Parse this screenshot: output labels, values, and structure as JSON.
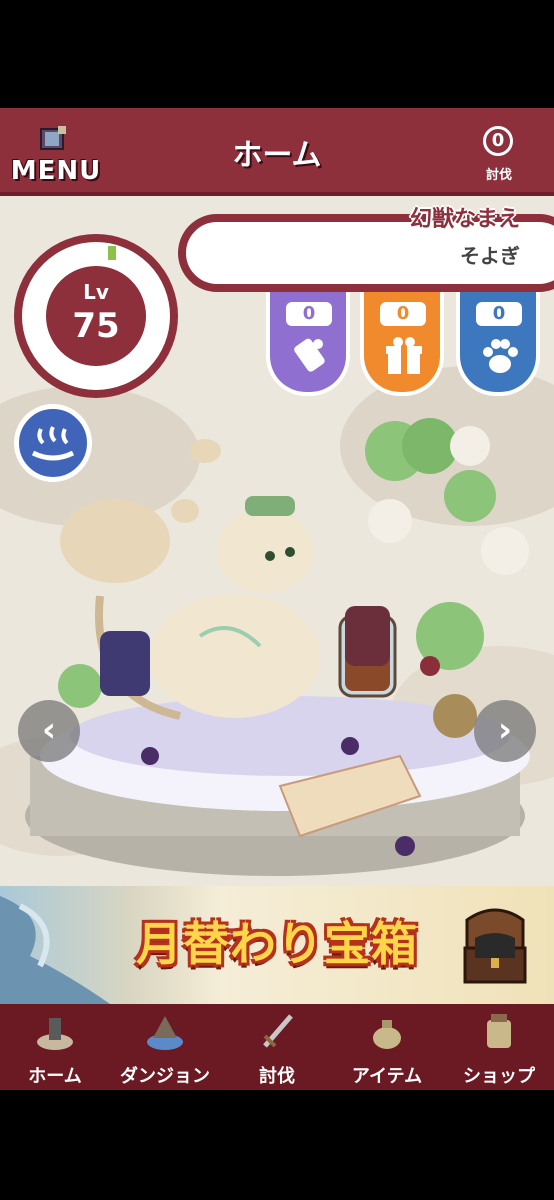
{
  "header": {
    "menu_label": "MENU",
    "title": "ホーム",
    "defeat_count": "0",
    "defeat_label": "討伐"
  },
  "pet": {
    "level_prefix": "Lv",
    "level": "75",
    "name_label": "幻獣なまえ",
    "name": "そよぎ"
  },
  "badges": [
    {
      "count": "0",
      "icon": "scroll-icon",
      "color": "#8f6fcf"
    },
    {
      "count": "0",
      "icon": "gift-icon",
      "color": "#f08a2c"
    },
    {
      "count": "0",
      "icon": "paw-icon",
      "color": "#3d77bd"
    }
  ],
  "banner": {
    "title": "月替わり宝箱"
  },
  "nav": [
    {
      "label": "ホーム",
      "icon": "home-icon"
    },
    {
      "label": "ダンジョン",
      "icon": "dungeon-icon"
    },
    {
      "label": "討伐",
      "icon": "sword-icon"
    },
    {
      "label": "アイテム",
      "icon": "item-bag-icon"
    },
    {
      "label": "ショップ",
      "icon": "shop-icon"
    }
  ],
  "colors": {
    "primary": "#8e2f3c",
    "nav_bg": "#6b1a23",
    "scene_bg": "#ece7dc"
  }
}
